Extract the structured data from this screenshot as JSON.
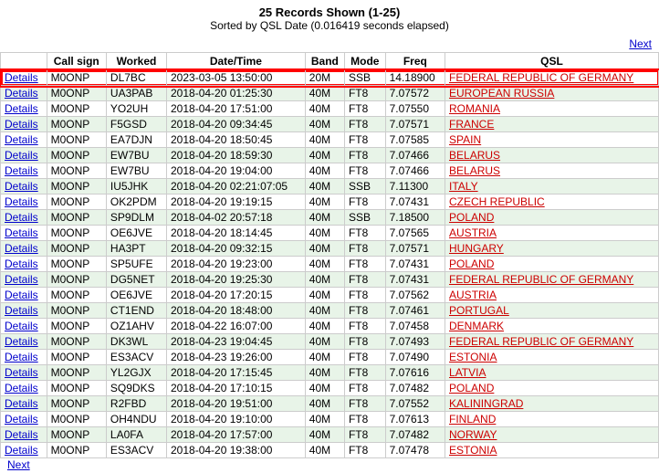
{
  "header": {
    "title": "25 Records Shown (1-25)",
    "subtitle": "Sorted by QSL Date (0.016419 seconds elapsed)"
  },
  "next_top": "Next",
  "next_bottom": "Next",
  "columns": [
    "Call sign",
    "Worked",
    "Date/Time",
    "Band",
    "Mode",
    "Freq",
    "QSL"
  ],
  "rows": [
    {
      "details": "Details",
      "callsign": "M0ONP",
      "worked": "DL7BC",
      "datetime": "2023-03-05 13:50:00",
      "band": "20M",
      "mode": "SSB",
      "freq": "14.18900",
      "qsl": "FEDERAL REPUBLIC OF GERMANY",
      "highlight": true
    },
    {
      "details": "Details",
      "callsign": "M0ONP",
      "worked": "UA3PAB",
      "datetime": "2018-04-20 01:25:30",
      "band": "40M",
      "mode": "FT8",
      "freq": "7.07572",
      "qsl": "EUROPEAN RUSSIA"
    },
    {
      "details": "Details",
      "callsign": "M0ONP",
      "worked": "YO2UH",
      "datetime": "2018-04-20 17:51:00",
      "band": "40M",
      "mode": "FT8",
      "freq": "7.07550",
      "qsl": "ROMANIA"
    },
    {
      "details": "Details",
      "callsign": "M0ONP",
      "worked": "F5GSD",
      "datetime": "2018-04-20 09:34:45",
      "band": "40M",
      "mode": "FT8",
      "freq": "7.07571",
      "qsl": "FRANCE"
    },
    {
      "details": "Details",
      "callsign": "M0ONP",
      "worked": "EA7DJN",
      "datetime": "2018-04-20 18:50:45",
      "band": "40M",
      "mode": "FT8",
      "freq": "7.07585",
      "qsl": "SPAIN"
    },
    {
      "details": "Details",
      "callsign": "M0ONP",
      "worked": "EW7BU",
      "datetime": "2018-04-20 18:59:30",
      "band": "40M",
      "mode": "FT8",
      "freq": "7.07466",
      "qsl": "BELARUS"
    },
    {
      "details": "Details",
      "callsign": "M0ONP",
      "worked": "EW7BU",
      "datetime": "2018-04-20 19:04:00",
      "band": "40M",
      "mode": "FT8",
      "freq": "7.07466",
      "qsl": "BELARUS"
    },
    {
      "details": "Details",
      "callsign": "M0ONP",
      "worked": "IU5JHK",
      "datetime": "2018-04-20 02:21:07:05",
      "band": "40M",
      "mode": "SSB",
      "freq": "7.11300",
      "qsl": "ITALY"
    },
    {
      "details": "Details",
      "callsign": "M0ONP",
      "worked": "OK2PDM",
      "datetime": "2018-04-20 19:19:15",
      "band": "40M",
      "mode": "FT8",
      "freq": "7.07431",
      "qsl": "CZECH REPUBLIC"
    },
    {
      "details": "Details",
      "callsign": "M0ONP",
      "worked": "SP9DLM",
      "datetime": "2018-04-02 20:57:18",
      "band": "40M",
      "mode": "SSB",
      "freq": "7.18500",
      "qsl": "POLAND"
    },
    {
      "details": "Details",
      "callsign": "M0ONP",
      "worked": "OE6JVE",
      "datetime": "2018-04-20 18:14:45",
      "band": "40M",
      "mode": "FT8",
      "freq": "7.07565",
      "qsl": "AUSTRIA"
    },
    {
      "details": "Details",
      "callsign": "M0ONP",
      "worked": "HA3PT",
      "datetime": "2018-04-20 09:32:15",
      "band": "40M",
      "mode": "FT8",
      "freq": "7.07571",
      "qsl": "HUNGARY"
    },
    {
      "details": "Details",
      "callsign": "M0ONP",
      "worked": "SP5UFE",
      "datetime": "2018-04-20 19:23:00",
      "band": "40M",
      "mode": "FT8",
      "freq": "7.07431",
      "qsl": "POLAND"
    },
    {
      "details": "Details",
      "callsign": "M0ONP",
      "worked": "DG5NET",
      "datetime": "2018-04-20 19:25:30",
      "band": "40M",
      "mode": "FT8",
      "freq": "7.07431",
      "qsl": "FEDERAL REPUBLIC OF GERMANY"
    },
    {
      "details": "Details",
      "callsign": "M0ONP",
      "worked": "OE6JVE",
      "datetime": "2018-04-20 17:20:15",
      "band": "40M",
      "mode": "FT8",
      "freq": "7.07562",
      "qsl": "AUSTRIA"
    },
    {
      "details": "Details",
      "callsign": "M0ONP",
      "worked": "CT1END",
      "datetime": "2018-04-20 18:48:00",
      "band": "40M",
      "mode": "FT8",
      "freq": "7.07461",
      "qsl": "PORTUGAL"
    },
    {
      "details": "Details",
      "callsign": "M0ONP",
      "worked": "OZ1AHV",
      "datetime": "2018-04-22 16:07:00",
      "band": "40M",
      "mode": "FT8",
      "freq": "7.07458",
      "qsl": "DENMARK"
    },
    {
      "details": "Details",
      "callsign": "M0ONP",
      "worked": "DK3WL",
      "datetime": "2018-04-23 19:04:45",
      "band": "40M",
      "mode": "FT8",
      "freq": "7.07493",
      "qsl": "FEDERAL REPUBLIC OF GERMANY"
    },
    {
      "details": "Details",
      "callsign": "M0ONP",
      "worked": "ES3ACV",
      "datetime": "2018-04-23 19:26:00",
      "band": "40M",
      "mode": "FT8",
      "freq": "7.07490",
      "qsl": "ESTONIA"
    },
    {
      "details": "Details",
      "callsign": "M0ONP",
      "worked": "YL2GJX",
      "datetime": "2018-04-20 17:15:45",
      "band": "40M",
      "mode": "FT8",
      "freq": "7.07616",
      "qsl": "LATVIA"
    },
    {
      "details": "Details",
      "callsign": "M0ONP",
      "worked": "SQ9DKS",
      "datetime": "2018-04-20 17:10:15",
      "band": "40M",
      "mode": "FT8",
      "freq": "7.07482",
      "qsl": "POLAND"
    },
    {
      "details": "Details",
      "callsign": "M0ONP",
      "worked": "R2FBD",
      "datetime": "2018-04-20 19:51:00",
      "band": "40M",
      "mode": "FT8",
      "freq": "7.07552",
      "qsl": "KALININGRAD"
    },
    {
      "details": "Details",
      "callsign": "M0ONP",
      "worked": "OH4NDU",
      "datetime": "2018-04-20 19:10:00",
      "band": "40M",
      "mode": "FT8",
      "freq": "7.07613",
      "qsl": "FINLAND"
    },
    {
      "details": "Details",
      "callsign": "M0ONP",
      "worked": "LA0FA",
      "datetime": "2018-04-20 17:57:00",
      "band": "40M",
      "mode": "FT8",
      "freq": "7.07482",
      "qsl": "NORWAY"
    },
    {
      "details": "Details",
      "callsign": "M0ONP",
      "worked": "ES3ACV",
      "datetime": "2018-04-20 19:38:00",
      "band": "40M",
      "mode": "FT8",
      "freq": "7.07478",
      "qsl": "ESTONIA"
    }
  ]
}
